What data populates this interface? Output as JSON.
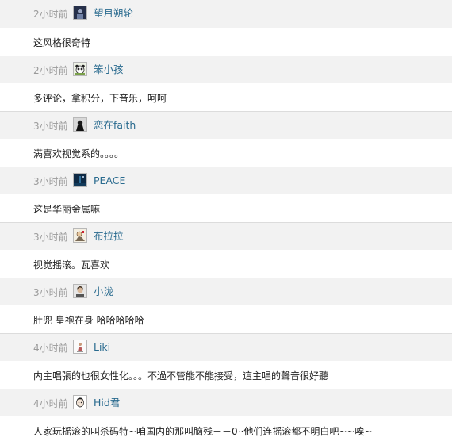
{
  "comments": [
    {
      "time": "2小时前",
      "user": "望月朔轮",
      "text": "这风格很奇特",
      "avatar": "dark-figure"
    },
    {
      "time": "2小时前",
      "user": "笨小孩",
      "text": "多评论，拿积分，下音乐，呵呵",
      "avatar": "panda"
    },
    {
      "time": "3小时前",
      "user": "恋在faith",
      "text": "满喜欢视觉系的。。。。",
      "avatar": "dark-figure"
    },
    {
      "time": "3小时前",
      "user": "PEACE",
      "text": "这是华丽金属嘛",
      "avatar": "night-scene"
    },
    {
      "time": "3小时前",
      "user": "布拉拉",
      "text": "视觉摇滚。瓦喜欢",
      "avatar": "cartoon"
    },
    {
      "time": "3小时前",
      "user": "小泷",
      "text": "肚兜 皇袍在身 哈哈哈哈哈",
      "avatar": "portrait"
    },
    {
      "time": "4小时前",
      "user": "Liki",
      "text": "内主唱張的也很女性化。。。不過不管能不能接受，這主唱的聲音很好聽",
      "avatar": "small-figure"
    },
    {
      "time": "4小时前",
      "user": "Hid君",
      "text": "人家玩摇滚的叫杀码特~咱国内的那叫脑残－－0··他们连摇滚都不明白吧~~唉~",
      "avatar": "face"
    }
  ]
}
